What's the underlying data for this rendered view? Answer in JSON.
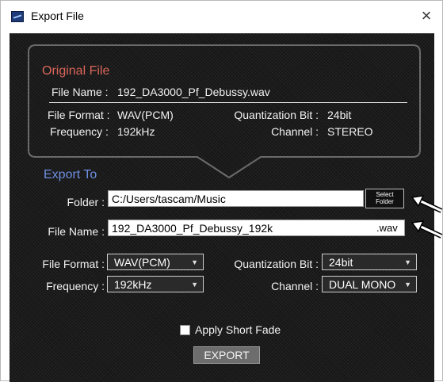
{
  "window": {
    "title": "Export File",
    "close_glyph": "×"
  },
  "original_file": {
    "title": "Original File",
    "file_name_label": "File Name :",
    "file_name_value": "192_DA3000_Pf_Debussy.wav",
    "file_format_label": "File Format :",
    "file_format_value": "WAV(PCM)",
    "quantization_label": "Quantization Bit :",
    "quantization_value": "24bit",
    "frequency_label": "Frequency :",
    "frequency_value": "192kHz",
    "channel_label": "Channel :",
    "channel_value": "STEREO"
  },
  "export_to": {
    "title": "Export To",
    "folder_label": "Folder :",
    "folder_value": "C:/Users/tascam/Music",
    "select_folder_line1": "Select",
    "select_folder_line2": "Folder",
    "file_name_label": "File Name :",
    "file_name_value": "192_DA3000_Pf_Debussy_192k",
    "file_extension": ".wav",
    "file_format_label": "File Format :",
    "file_format_value": "WAV(PCM)",
    "quantization_label": "Quantization Bit :",
    "quantization_value": "24bit",
    "frequency_label": "Frequency :",
    "frequency_value": "192kHz",
    "channel_label": "Channel :",
    "channel_value": "DUAL MONO",
    "dropdown_arrow": "▼"
  },
  "options": {
    "apply_short_fade_label": "Apply Short Fade",
    "apply_short_fade_checked": false
  },
  "actions": {
    "export_label": "EXPORT"
  },
  "colors": {
    "section_title_original": "#d9665a",
    "section_title_export": "#6f8fe3",
    "panel_background": "#161616",
    "callout_arrow": "#ffffff"
  }
}
